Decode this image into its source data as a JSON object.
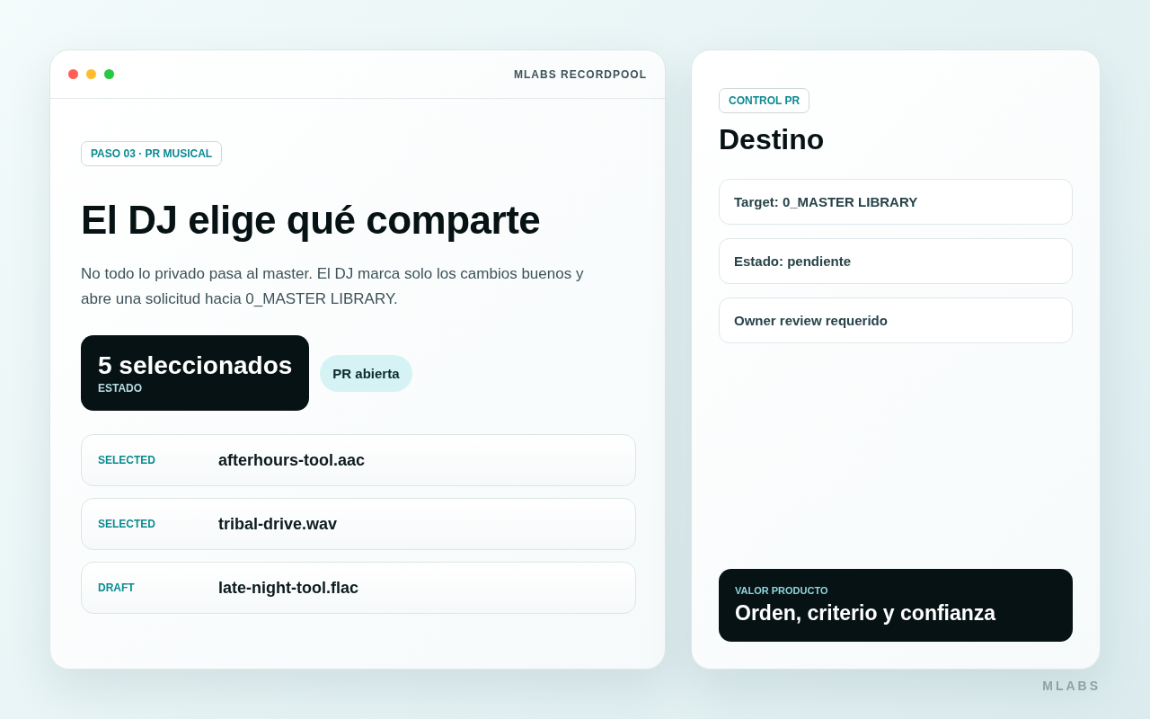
{
  "window": {
    "title": "MLABS RECORDPOOL"
  },
  "step_badge": "PASO 03 · PR MUSICAL",
  "heading": "El DJ elige qué comparte",
  "description": "No todo lo privado pasa al master. El DJ marca solo los cambios buenos y abre una solicitud hacia 0_MASTER LIBRARY.",
  "status_card": {
    "value": "5 seleccionados",
    "label": "ESTADO"
  },
  "status_pill": "PR abierta",
  "files": [
    {
      "status": "SELECTED",
      "name": "afterhours-tool.aac"
    },
    {
      "status": "SELECTED",
      "name": "tribal-drive.wav"
    },
    {
      "status": "DRAFT",
      "name": "late-night-tool.flac"
    }
  ],
  "side_panel": {
    "badge": "CONTROL PR",
    "title": "Destino",
    "items": [
      "Target: 0_MASTER LIBRARY",
      "Estado: pendiente",
      "Owner review requerido"
    ],
    "value_card": {
      "label": "VALOR PRODUCTO",
      "text": "Orden, criterio y confianza"
    }
  },
  "brand": "MLABS"
}
